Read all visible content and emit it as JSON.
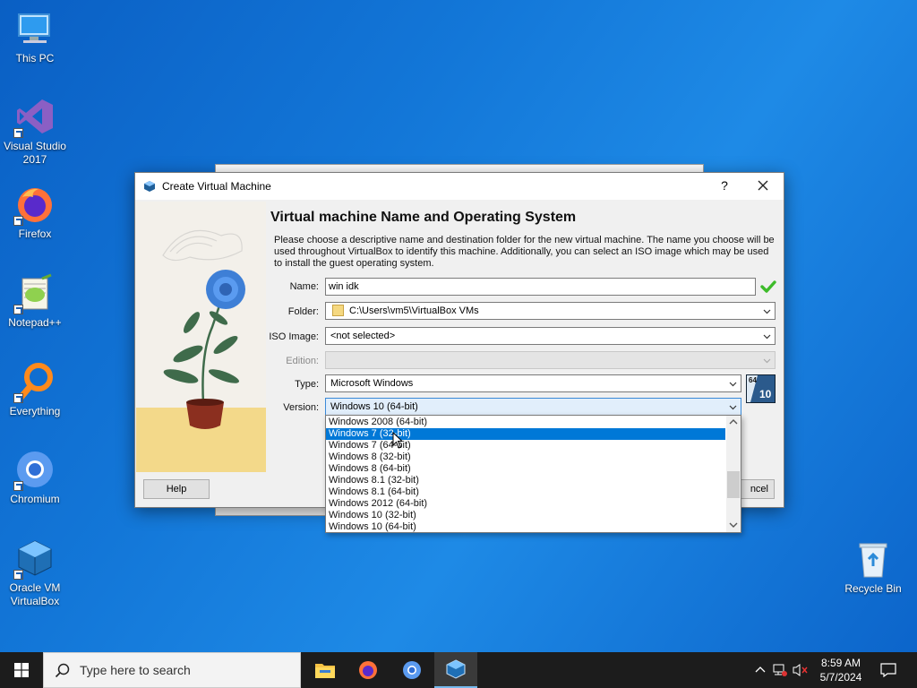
{
  "desktop": {
    "icons": [
      {
        "label": "This PC"
      },
      {
        "label": "Visual Studio 2017"
      },
      {
        "label": "Firefox"
      },
      {
        "label": "Notepad++"
      },
      {
        "label": "Everything"
      },
      {
        "label": "Chromium"
      },
      {
        "label": "Oracle VM VirtualBox"
      },
      {
        "label": "Recycle Bin"
      }
    ]
  },
  "dialog": {
    "title": "Create Virtual Machine",
    "help_glyph": "?",
    "heading": "Virtual machine Name and Operating System",
    "description": "Please choose a descriptive name and destination folder for the new virtual machine. The name you choose will be used throughout VirtualBox to identify this machine. Additionally, you can select an ISO image which may be used to install the guest operating system.",
    "labels": {
      "name": "Name:",
      "folder": "Folder:",
      "iso": "ISO Image:",
      "edition": "Edition:",
      "type": "Type:",
      "version": "Version:"
    },
    "values": {
      "name": "win idk",
      "folder": "C:\\Users\\vm5\\VirtualBox VMs",
      "iso": "<not selected>",
      "edition": "",
      "type": "Microsoft Windows",
      "version": "Windows 10 (64-bit)"
    },
    "os_badge": {
      "bits": "64",
      "version": "10"
    },
    "buttons": {
      "help": "Help",
      "cancel": "ncel"
    },
    "version_options": [
      "Windows 2008 (64-bit)",
      "Windows 7 (32-bit)",
      "Windows 7 (64-bit)",
      "Windows 8 (32-bit)",
      "Windows 8 (64-bit)",
      "Windows 8.1 (32-bit)",
      "Windows 8.1 (64-bit)",
      "Windows 2012 (64-bit)",
      "Windows 10 (32-bit)",
      "Windows 10 (64-bit)"
    ],
    "highlighted_option": "Windows 7 (32-bit)"
  },
  "taskbar": {
    "search_placeholder": "Type here to search",
    "time": "8:59 AM",
    "date": "5/7/2024",
    "apps": [
      "file-explorer-icon",
      "firefox-icon",
      "chromium-icon",
      "virtualbox-icon"
    ]
  },
  "colors": {
    "accent": "#0078d7",
    "desktop_blue": "#1377d8",
    "taskbar": "#1c1c1c",
    "valid_check": "#3dbb2a"
  }
}
